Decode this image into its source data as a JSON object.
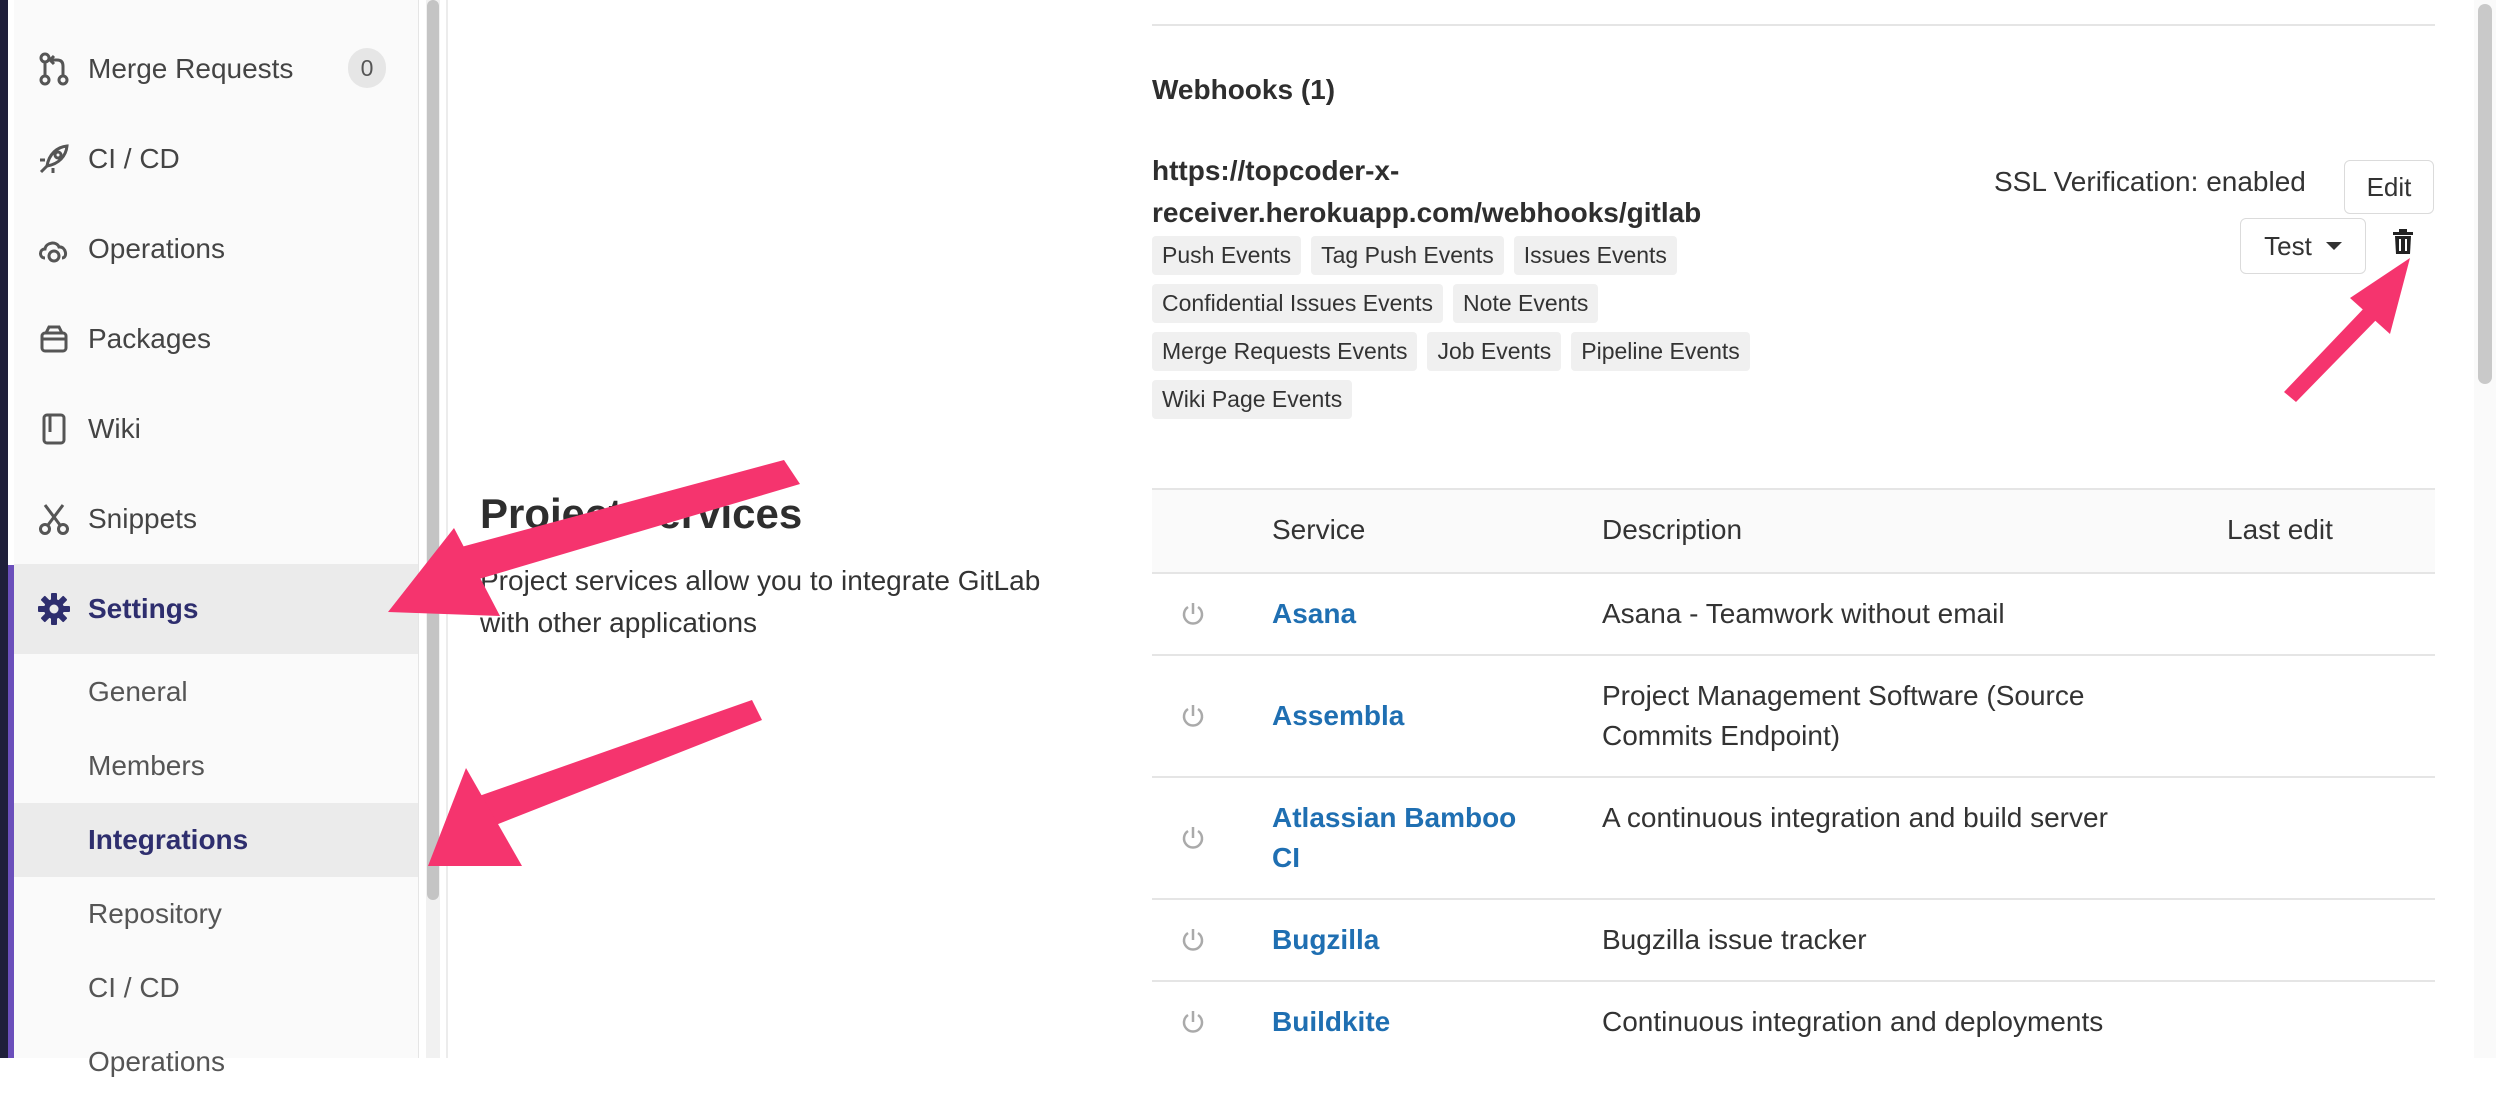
{
  "sidebar": {
    "items": [
      {
        "label": "Merge Requests",
        "badge": "0",
        "icon": "merge-request-icon"
      },
      {
        "label": "CI / CD",
        "icon": "rocket-icon"
      },
      {
        "label": "Operations",
        "icon": "cloud-gear-icon"
      },
      {
        "label": "Packages",
        "icon": "package-icon"
      },
      {
        "label": "Wiki",
        "icon": "book-icon"
      },
      {
        "label": "Snippets",
        "icon": "scissors-icon"
      },
      {
        "label": "Settings",
        "icon": "gear-icon",
        "active": true
      }
    ],
    "settings_submenu": [
      {
        "label": "General"
      },
      {
        "label": "Members"
      },
      {
        "label": "Integrations",
        "active": true
      },
      {
        "label": "Repository"
      },
      {
        "label": "CI / CD"
      },
      {
        "label": "Operations"
      }
    ]
  },
  "project_services": {
    "title": "Project services",
    "description": "Project services allow you to integrate GitLab with other applications"
  },
  "webhooks": {
    "title": "Webhooks (1)",
    "url": "https://topcoder-x-receiver.herokuapp.com/webhooks/gitlab",
    "events": [
      "Push Events",
      "Tag Push Events",
      "Issues Events",
      "Confidential Issues Events",
      "Note Events",
      "Merge Requests Events",
      "Job Events",
      "Pipeline Events",
      "Wiki Page Events"
    ],
    "ssl": "SSL Verification: enabled",
    "edit_label": "Edit",
    "test_label": "Test",
    "delete_icon": "trash-icon"
  },
  "services_table": {
    "headers": {
      "service": "Service",
      "description": "Description",
      "last_edit": "Last edit"
    },
    "rows": [
      {
        "name": "Asana",
        "description": "Asana - Teamwork without email"
      },
      {
        "name": "Assembla",
        "description": "Project Management Software (Source Commits Endpoint)"
      },
      {
        "name": "Atlassian Bamboo CI",
        "description": "A continuous integration and build server"
      },
      {
        "name": "Bugzilla",
        "description": "Bugzilla issue tracker"
      },
      {
        "name": "Buildkite",
        "description": "Continuous integration and deployments"
      }
    ]
  },
  "colors": {
    "link": "#1f6fb2",
    "active_nav": "#2e2e6e",
    "annotation_arrow": "#f5346e"
  }
}
